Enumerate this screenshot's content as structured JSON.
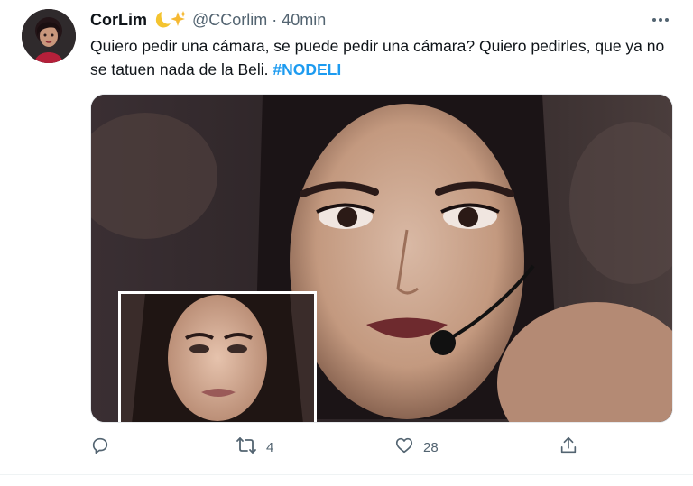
{
  "tweet": {
    "author_name": "CorLim",
    "author_emoji": "moon-and-sparkles",
    "handle": "@CCorlim",
    "separator": "·",
    "time": "40min",
    "text": "Quiero pedir una cámara, se puede pedir una cámara? Quiero pedirles, que ya no se tatuen nada de la Beli.",
    "hashtag": "#NODELI",
    "more_icon": "more-horizontal-icon"
  },
  "actions": {
    "reply": {
      "icon": "reply-icon",
      "count": ""
    },
    "retweet": {
      "icon": "retweet-icon",
      "count": "4"
    },
    "like": {
      "icon": "heart-icon",
      "count": "28"
    },
    "share": {
      "icon": "share-icon",
      "count": ""
    }
  },
  "colors": {
    "text": "#0f1419",
    "secondary": "#536471",
    "link": "#1d9bf0",
    "emoji_moon": "#f4c430",
    "emoji_sparkles": "#f6b932"
  }
}
